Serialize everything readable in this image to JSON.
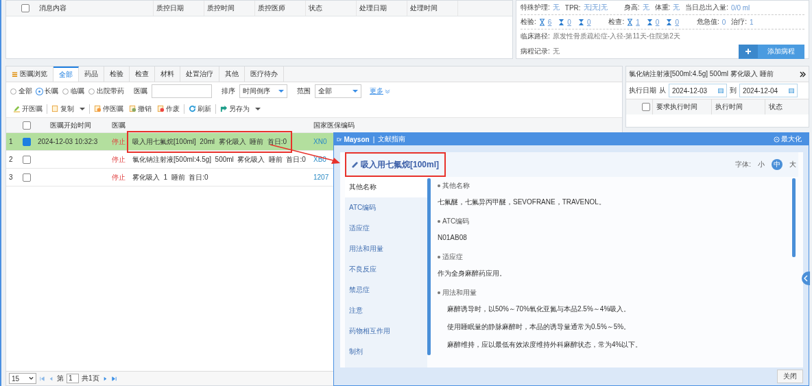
{
  "qc_table": {
    "all_checked": false,
    "columns": [
      "消息内容",
      "质控日期",
      "质控时间",
      "质控医师",
      "状态",
      "处理日期",
      "处理时间"
    ]
  },
  "patient_info": {
    "row1": [
      {
        "label": "特殊护理:",
        "value": "无"
      },
      {
        "label": "TPR:",
        "value": "无|无|无"
      },
      {
        "label": "身高:",
        "value": "无"
      },
      {
        "label": "体重:",
        "value": "无"
      },
      {
        "label": "当日总出入量:",
        "value": "0/0 ml"
      }
    ],
    "row2": [
      {
        "kind": "hourglass",
        "label": "检验:",
        "counts": [
          "6",
          "0",
          "0"
        ]
      },
      {
        "kind": "hourglass",
        "label": "检查:",
        "counts": [
          "1",
          "0",
          "0"
        ]
      },
      {
        "kind": "plain",
        "label": "危急值:",
        "value": "0"
      },
      {
        "kind": "plain",
        "label": "治疗:",
        "value": "1"
      }
    ],
    "clinical_path": {
      "label": "临床路径:",
      "value": "原发性骨质疏松症-入径-第11天-住院第2天"
    },
    "progress_note": {
      "label": "病程记录:",
      "value": "无"
    },
    "add_button": "添加病程"
  },
  "orders": {
    "tabs": [
      {
        "label": "医嘱浏览",
        "selected": false
      },
      {
        "label": "全部",
        "selected": true
      },
      {
        "label": "药品",
        "selected": false
      },
      {
        "label": "检验",
        "selected": false
      },
      {
        "label": "检查",
        "selected": false
      },
      {
        "label": "材料",
        "selected": false
      },
      {
        "label": "处置治疗",
        "selected": false
      },
      {
        "label": "其他",
        "selected": false
      },
      {
        "label": "医疗待办",
        "selected": false
      }
    ],
    "radios": [
      {
        "label": "全部",
        "selected": false
      },
      {
        "label": "长嘱",
        "selected": true
      },
      {
        "label": "临嘱",
        "selected": false
      },
      {
        "label": "出院带药",
        "selected": false
      }
    ],
    "order_filter_label": "医嘱",
    "sort": {
      "label": "排序",
      "value": "时间倒序"
    },
    "range": {
      "label": "范围",
      "value": "全部"
    },
    "more_link": "更多",
    "toolbar": [
      {
        "kind": "edit",
        "label": "开医嘱",
        "dropdown": false,
        "divider_after": true
      },
      {
        "kind": "copy",
        "label": "复制",
        "dropdown": true,
        "divider_after": true
      },
      {
        "kind": "stop",
        "label": "停医嘱",
        "dropdown": false,
        "divider_after": false
      },
      {
        "kind": "undo",
        "label": "撤销",
        "dropdown": false,
        "divider_after": false
      },
      {
        "kind": "void",
        "label": "作废",
        "dropdown": false,
        "divider_after": true
      },
      {
        "kind": "refresh",
        "label": "刷新",
        "dropdown": false,
        "divider_after": true
      },
      {
        "kind": "save",
        "label": "另存为",
        "dropdown": true,
        "divider_after": false
      }
    ],
    "all_checked": false,
    "columns": [
      "医嘱开始时间",
      "医嘱",
      "国家医保编码"
    ],
    "rows": [
      {
        "num": "1",
        "checked": true,
        "selected": true,
        "highlighted": true,
        "start": "2024-12-03 10:32:3",
        "status": "停止",
        "order": "吸入用七氟烷[100ml]  20ml  雾化吸入  睡前  首日:0",
        "code": "XN0"
      },
      {
        "num": "2",
        "checked": false,
        "selected": false,
        "highlighted": false,
        "start": "",
        "status": "停止",
        "order": "氯化钠注射液[500ml:4.5g]  500ml  雾化吸入  睡前  首日:0",
        "code": "XB0"
      },
      {
        "num": "3",
        "checked": false,
        "selected": false,
        "highlighted": false,
        "start": "",
        "status": "停止",
        "order": "雾化吸入  1  睡前  首日:0",
        "code": "1207"
      }
    ],
    "pager": {
      "page_size": "15",
      "page_prefix": "第",
      "page": "1",
      "total": "共1页"
    }
  },
  "execution": {
    "header": "氯化钠注射液[500ml:4.5g] 500ml 雾化吸入 睡前",
    "date_label": "执行日期",
    "from": "从",
    "from_date": "2024-12-03",
    "to": "到",
    "to_date": "2024-12-04",
    "all_checked": false,
    "columns": [
      "要求执行时间",
      "执行时间",
      "状态"
    ]
  },
  "popup": {
    "brand_prefix": "Dr",
    "brand": "Mayson",
    "brand_separator": "|",
    "title": "文献指南",
    "maximize": "最大化",
    "drug_title": "吸入用七氟烷[100ml]",
    "title_highlighted": true,
    "font_label": "字体:",
    "font_sizes": [
      {
        "label": "小",
        "selected": false
      },
      {
        "label": "中",
        "selected": true
      },
      {
        "label": "大",
        "selected": false
      }
    ],
    "nav": [
      {
        "label": "其他名称",
        "selected": true
      },
      {
        "label": "ATC编码",
        "selected": false
      },
      {
        "label": "适应症",
        "selected": false
      },
      {
        "label": "用法和用量",
        "selected": false
      },
      {
        "label": "不良反应",
        "selected": false
      },
      {
        "label": "禁忌症",
        "selected": false
      },
      {
        "label": "注意",
        "selected": false
      },
      {
        "label": "药物相互作用",
        "selected": false
      },
      {
        "label": "制剂",
        "selected": false
      }
    ],
    "sections": [
      {
        "heading": "其他名称",
        "indented": false,
        "paragraphs": [
          "七氟醚，七氟异丙甲醚，SEVOFRANE，TRAVENOL。"
        ]
      },
      {
        "heading": "ATC编码",
        "indented": false,
        "paragraphs": [
          "N01AB08"
        ]
      },
      {
        "heading": "适应症",
        "indented": false,
        "paragraphs": [
          "作为全身麻醉药应用。"
        ]
      },
      {
        "heading": "用法和用量",
        "indented": true,
        "paragraphs": [
          "麻醉诱导时，以50%～70%氧化亚氮与本品2.5%～4%吸入。",
          "使用睡眠量的静脉麻醉时，本品的诱导量通常为0.5%～5%。",
          "麻醉维持，应以最低有效浓度维持外科麻醉状态，常为4%以下。"
        ]
      }
    ],
    "close": "关闭"
  }
}
